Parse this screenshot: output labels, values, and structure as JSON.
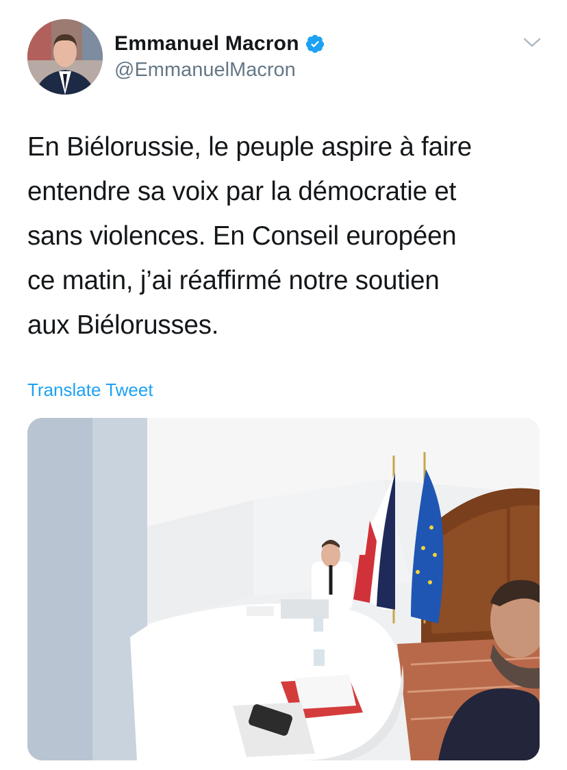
{
  "author": {
    "name": "Emmanuel Macron",
    "handle": "@EmmanuelMacron",
    "verified": true
  },
  "tweet": {
    "text": "En Biélorussie, le peuple aspire à faire\nentendre sa voix par la démocratie et\nsans violences. En Conseil européen\nce matin, j’ai réaffirmé notre soutien\naux Biélorusses.",
    "translate_label": "Translate Tweet"
  },
  "icons": {
    "verified": "verified-badge-icon",
    "more": "chevron-down-icon"
  },
  "colors": {
    "link": "#1da1f2",
    "handle": "#657786",
    "text": "#14171a"
  }
}
